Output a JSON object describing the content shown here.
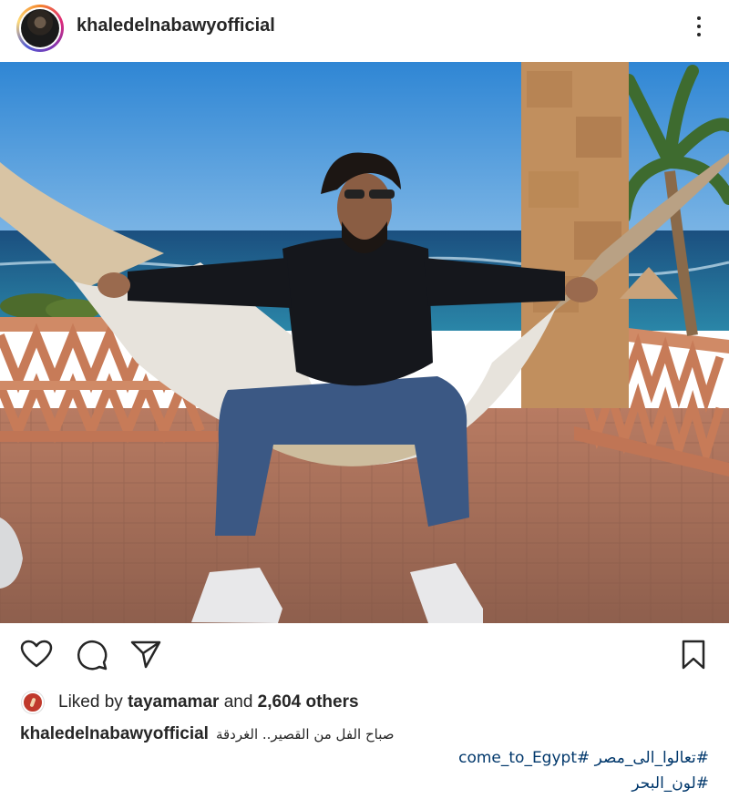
{
  "post": {
    "username": "khaledelnabawyofficial",
    "photo_alt": "",
    "likes": {
      "prefix": "Liked by",
      "user": "tayamamar",
      "middle": "and",
      "count": "2,604 others"
    },
    "caption": {
      "username": "khaledelnabawyofficial",
      "text": "صباح الفل من القصير.. الغردقة"
    },
    "hashtags": {
      "line1": "#تعالوا_الى_مصر #come_to_Egypt",
      "line2": "#لون_البحر"
    }
  },
  "icons": {
    "more": "more-vertical-icon",
    "like": "heart-icon",
    "comment": "comment-icon",
    "share": "share-icon",
    "save": "bookmark-icon"
  },
  "colors": {
    "text": "#262626",
    "hashtag": "#00376b",
    "sky": "#3f8fd6",
    "sea": "#1d5f8c"
  }
}
